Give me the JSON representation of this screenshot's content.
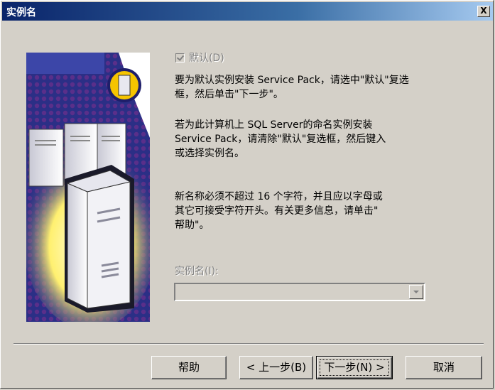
{
  "window": {
    "title": "实例名",
    "close_label": "X"
  },
  "default_checkbox": {
    "label": "默认(D)",
    "checked": true,
    "enabled": false
  },
  "paragraphs": [
    "要为默认实例安装 Service Pack，请选中\"默认\"复选\n框，然后单击\"下一步\"。",
    "若为此计算机上 SQL Server的命名实例安装\nService Pack，请清除\"默认\"复选框，然后键入\n或选择实例名。",
    "新名称必须不超过 16 个字符，并且应以字母或\n其它可接受字符开头。有关更多信息，请单击\"\n帮助\"。"
  ],
  "instance_name": {
    "label": "实例名(I):",
    "value": ""
  },
  "buttons": {
    "help": "帮助",
    "back": "< 上一步(B)",
    "next": "下一步(N) >",
    "cancel": "取消"
  }
}
